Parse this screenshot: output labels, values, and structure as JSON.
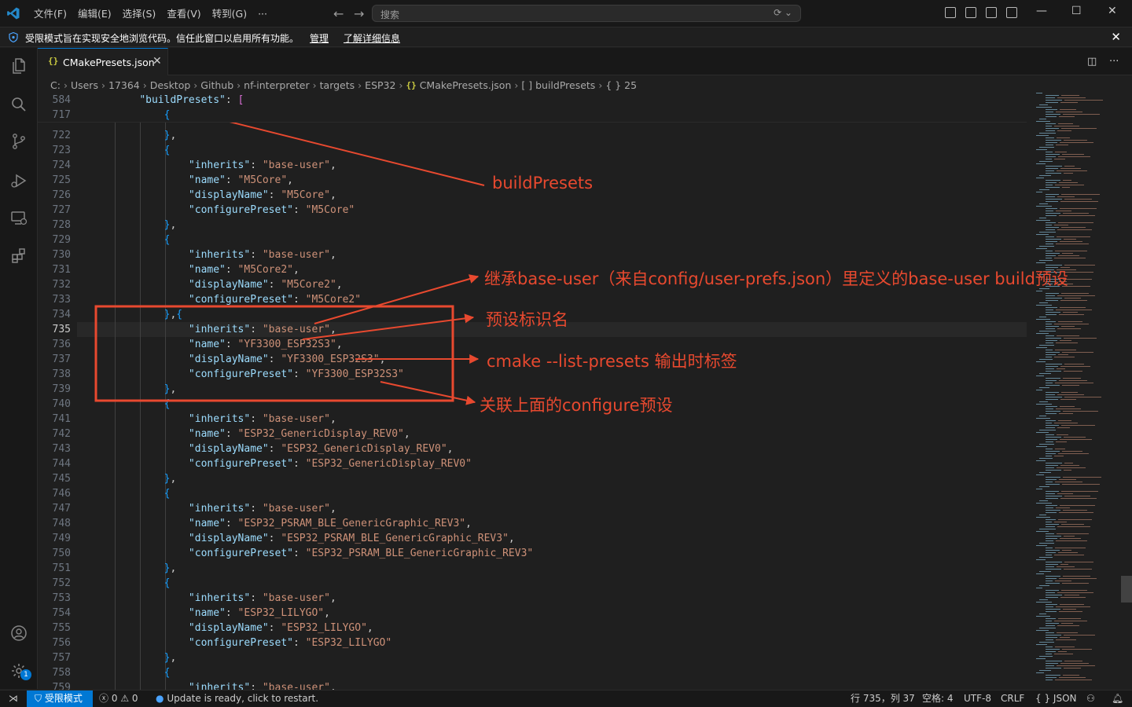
{
  "titlebar": {
    "menu": [
      "文件(F)",
      "编辑(E)",
      "选择(S)",
      "查看(V)",
      "转到(G)",
      "···"
    ],
    "search_placeholder": "搜索"
  },
  "banner": {
    "text": "受限模式旨在实现安全地浏览代码。信任此窗口以启用所有功能。",
    "manage": "管理",
    "learn_more": "了解详细信息"
  },
  "tab": {
    "label": "CMakePresets.json",
    "icon": "{}"
  },
  "breadcrumb": [
    "C:",
    "Users",
    "17364",
    "Desktop",
    "Github",
    "nf-interpreter",
    "targets",
    "ESP32",
    "CMakePresets.json",
    "[ ] buildPresets",
    "{ } 25"
  ],
  "sticky_lines": [
    {
      "n": "584",
      "text": "    \"buildPresets\": ["
    },
    {
      "n": "717",
      "text": "        {"
    }
  ],
  "lines": [
    {
      "n": "722",
      "text": "        },"
    },
    {
      "n": "723",
      "text": "        {"
    },
    {
      "n": "724",
      "text": "            \"inherits\": \"base-user\","
    },
    {
      "n": "725",
      "text": "            \"name\": \"M5Core\","
    },
    {
      "n": "726",
      "text": "            \"displayName\": \"M5Core\","
    },
    {
      "n": "727",
      "text": "            \"configurePreset\": \"M5Core\""
    },
    {
      "n": "728",
      "text": "        },"
    },
    {
      "n": "729",
      "text": "        {"
    },
    {
      "n": "730",
      "text": "            \"inherits\": \"base-user\","
    },
    {
      "n": "731",
      "text": "            \"name\": \"M5Core2\","
    },
    {
      "n": "732",
      "text": "            \"displayName\": \"M5Core2\","
    },
    {
      "n": "733",
      "text": "            \"configurePreset\": \"M5Core2\""
    },
    {
      "n": "734",
      "text": "        },{"
    },
    {
      "n": "735",
      "text": "            \"inherits\": \"base-user\","
    },
    {
      "n": "736",
      "text": "            \"name\": \"YF3300_ESP32S3\","
    },
    {
      "n": "737",
      "text": "            \"displayName\": \"YF3300_ESP32S3\","
    },
    {
      "n": "738",
      "text": "            \"configurePreset\": \"YF3300_ESP32S3\""
    },
    {
      "n": "739",
      "text": "        },"
    },
    {
      "n": "740",
      "text": "        {"
    },
    {
      "n": "741",
      "text": "            \"inherits\": \"base-user\","
    },
    {
      "n": "742",
      "text": "            \"name\": \"ESP32_GenericDisplay_REV0\","
    },
    {
      "n": "743",
      "text": "            \"displayName\": \"ESP32_GenericDisplay_REV0\","
    },
    {
      "n": "744",
      "text": "            \"configurePreset\": \"ESP32_GenericDisplay_REV0\""
    },
    {
      "n": "745",
      "text": "        },"
    },
    {
      "n": "746",
      "text": "        {"
    },
    {
      "n": "747",
      "text": "            \"inherits\": \"base-user\","
    },
    {
      "n": "748",
      "text": "            \"name\": \"ESP32_PSRAM_BLE_GenericGraphic_REV3\","
    },
    {
      "n": "749",
      "text": "            \"displayName\": \"ESP32_PSRAM_BLE_GenericGraphic_REV3\","
    },
    {
      "n": "750",
      "text": "            \"configurePreset\": \"ESP32_PSRAM_BLE_GenericGraphic_REV3\""
    },
    {
      "n": "751",
      "text": "        },"
    },
    {
      "n": "752",
      "text": "        {"
    },
    {
      "n": "753",
      "text": "            \"inherits\": \"base-user\","
    },
    {
      "n": "754",
      "text": "            \"name\": \"ESP32_LILYGO\","
    },
    {
      "n": "755",
      "text": "            \"displayName\": \"ESP32_LILYGO\","
    },
    {
      "n": "756",
      "text": "            \"configurePreset\": \"ESP32_LILYGO\""
    },
    {
      "n": "757",
      "text": "        },"
    },
    {
      "n": "758",
      "text": "        {"
    },
    {
      "n": "759",
      "text": "            \"inherits\": \"base-user\","
    }
  ],
  "current_line": "735",
  "annotations": {
    "build_presets": "buildPresets",
    "inherits": "继承base-user（来自config/user-prefs.json）里定义的base-user build预设",
    "name": "预设标识名",
    "display_name": "cmake --list-presets 输出时标签",
    "configure_preset": "关联上面的configure预设"
  },
  "statusbar": {
    "restricted": "受限模式",
    "errors": "0",
    "warnings": "0",
    "update": "Update is ready, click to restart.",
    "position": "行 735，列 37",
    "spaces": "空格: 4",
    "encoding": "UTF-8",
    "eol": "CRLF",
    "language": "JSON",
    "language_icon": "{ }"
  },
  "colors": {
    "accent": "#0078d4",
    "annotation": "#e8492f",
    "json_key": "#9cdcfe",
    "json_string": "#ce9178"
  },
  "badge_count": "1"
}
